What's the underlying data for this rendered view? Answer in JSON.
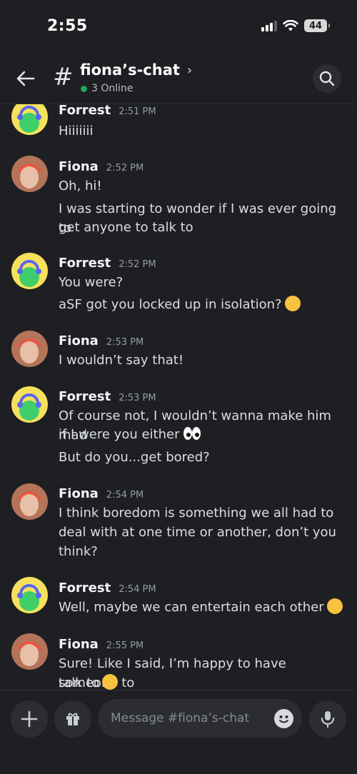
{
  "status_bar": {
    "time": "2:55",
    "battery": "44"
  },
  "header": {
    "channel": "fiona’s-chat",
    "online": "3 Online"
  },
  "messages": [
    {
      "author": "Forrest",
      "time": "2:51 PM",
      "lines": [
        "Hiiiiiii"
      ]
    },
    {
      "author": "Fiona",
      "time": "2:52 PM",
      "lines": [
        "Oh, hi!",
        "I was starting to wonder if I was ever going to",
        "get anyone to talk to"
      ]
    },
    {
      "author": "Forrest",
      "time": "2:52 PM",
      "lines": [
        "You were?",
        "aSF got you locked up in isolation?"
      ]
    },
    {
      "author": "Fiona",
      "time": "2:53 PM",
      "lines": [
        "I wouldn’t say that!"
      ]
    },
    {
      "author": "Forrest",
      "time": "2:53 PM",
      "lines": [
        "Of course not, I wouldn’t wanna make him mad",
        "if I were you either",
        "But do you...get bored?"
      ]
    },
    {
      "author": "Fiona",
      "time": "2:54 PM",
      "lines": [
        "I think boredom is something we all had to",
        "deal with at one time or another, don’t you",
        "think?"
      ]
    },
    {
      "author": "Forrest",
      "time": "2:54 PM",
      "lines": [
        "Well, maybe we can entertain each other"
      ]
    },
    {
      "author": "Fiona",
      "time": "2:55 PM",
      "lines": [
        "Sure! Like I said, I’m happy to have someone to",
        "talk to"
      ]
    }
  ],
  "composer": {
    "placeholder": "Message #fiona’s-chat"
  },
  "icons": {
    "back": "back-arrow-icon",
    "hash": "hash-icon",
    "search": "search-icon",
    "add": "plus-icon",
    "gift": "gift-icon",
    "emoji": "emoji-icon",
    "mic": "microphone-icon"
  },
  "colors": {
    "background": "#1e1f22",
    "online_dot": "#23a55a",
    "surface": "#2b2d31"
  }
}
